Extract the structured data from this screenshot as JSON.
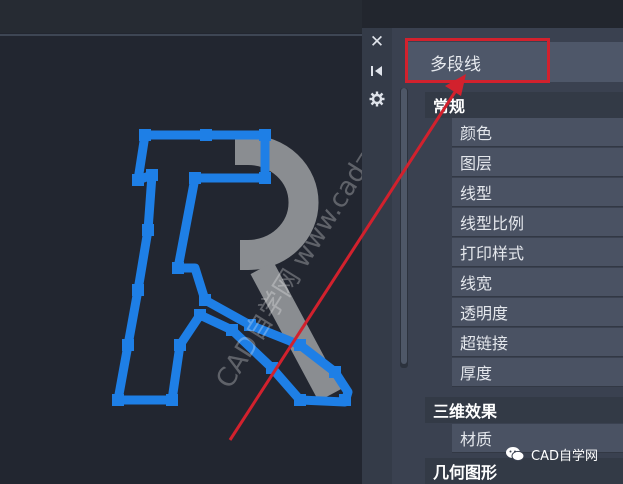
{
  "palette": {
    "object_type": "多段线",
    "categories": [
      {
        "label": "常规",
        "rows": [
          "颜色",
          "图层",
          "线型",
          "线型比例",
          "打印样式",
          "线宽",
          "透明度",
          "超链接",
          "厚度"
        ]
      },
      {
        "label": "三维效果",
        "rows": [
          "材质"
        ]
      },
      {
        "label": "几何图形",
        "rows": []
      }
    ]
  },
  "canvas": {
    "letter": "R",
    "watermark_text": "CAD自学网 www.cadzxw.com"
  },
  "watermark": {
    "text": "CAD自学网"
  },
  "colors": {
    "highlight": "#d2212d",
    "arrow": "#d2212d",
    "grips": "#1e7fe6",
    "logo_gray": "#8a8d91"
  }
}
